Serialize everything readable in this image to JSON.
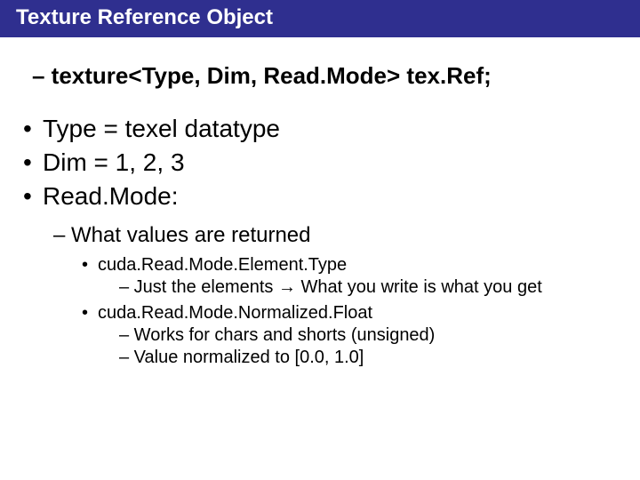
{
  "title": "Texture Reference Object",
  "declaration": "– texture<Type, Dim, Read.Mode> tex.Ref;",
  "b1": "Type = texel datatype",
  "b2": "Dim = 1, 2, 3",
  "b3": "Read.Mode:",
  "d1": "– What values are returned",
  "m1": "cuda.Read.Mode.Element.Type",
  "m1d1_pre": "– Just the elements ",
  "m1d1_post": " What you write is what you get",
  "arrow": "→",
  "m2": "cuda.Read.Mode.Normalized.Float",
  "m2d1": "– Works for chars and shorts (unsigned)",
  "m2d2": "– Value normalized to [0.0, 1.0]"
}
